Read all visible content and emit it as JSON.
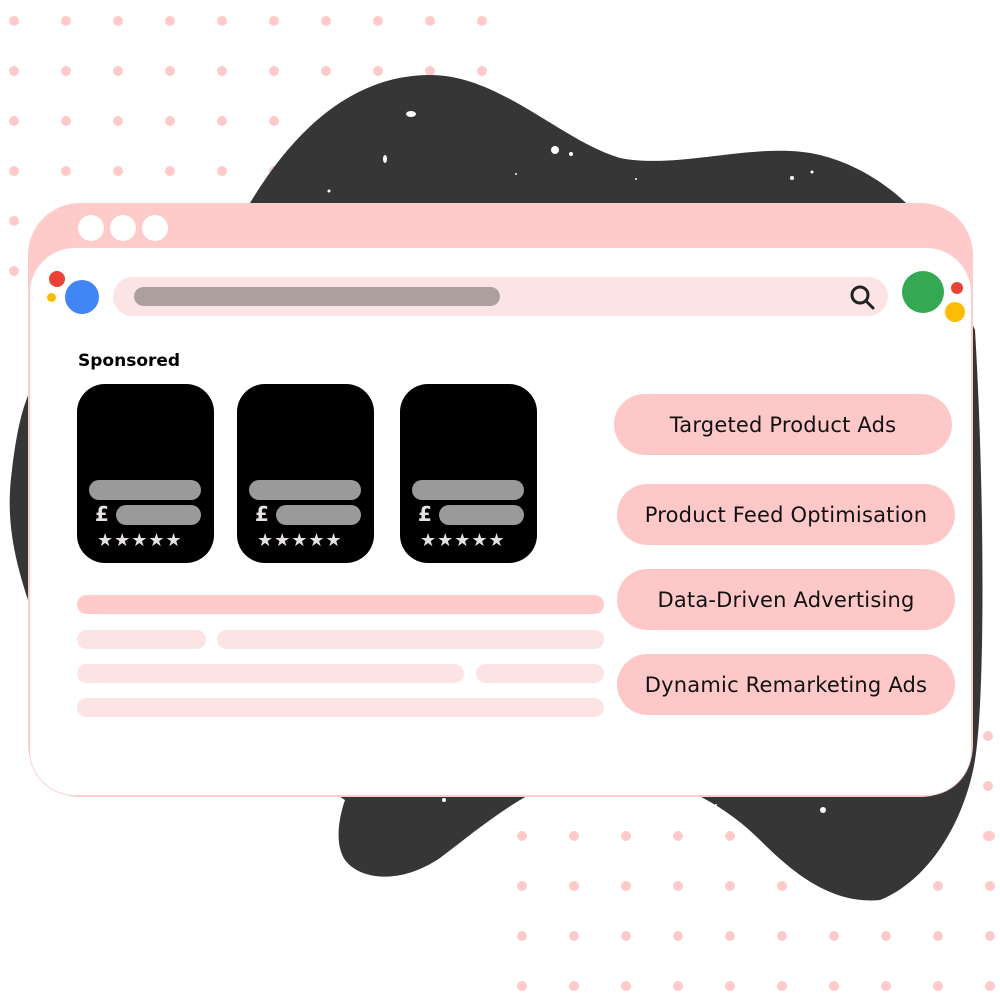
{
  "colors": {
    "dot_pink": "#fecaca",
    "blob_dark": "#363636",
    "window_frame": "#fecaca",
    "window_body": "#ffffff",
    "search_bg": "#fde4e4",
    "search_fill": "#ae9f9f",
    "pill_bg": "#fec8c8",
    "card_bg": "#000000",
    "card_bar": "#9a9a9a",
    "google_blue": "#4285f4",
    "google_red": "#ea4335",
    "google_yellow": "#fbbc05",
    "google_green": "#34a853"
  },
  "window": {
    "controls": [
      "window-dot",
      "window-dot",
      "window-dot"
    ]
  },
  "header": {
    "search_icon": "search-icon",
    "left_logo": "assistant-dots-icon",
    "right_logo": "assistant-dots-icon"
  },
  "main": {
    "section_label": "Sponsored",
    "products": [
      {
        "currency": "£",
        "rating": "★★★★★",
        "stars": 5
      },
      {
        "currency": "£",
        "rating": "★★★★★",
        "stars": 5
      },
      {
        "currency": "£",
        "rating": "★★★★★",
        "stars": 5
      }
    ]
  },
  "services": [
    {
      "label": "Targeted Product Ads"
    },
    {
      "label": "Product Feed Optimisation"
    },
    {
      "label": "Data-Driven Advertising"
    },
    {
      "label": "Dynamic Remarketing Ads"
    }
  ]
}
